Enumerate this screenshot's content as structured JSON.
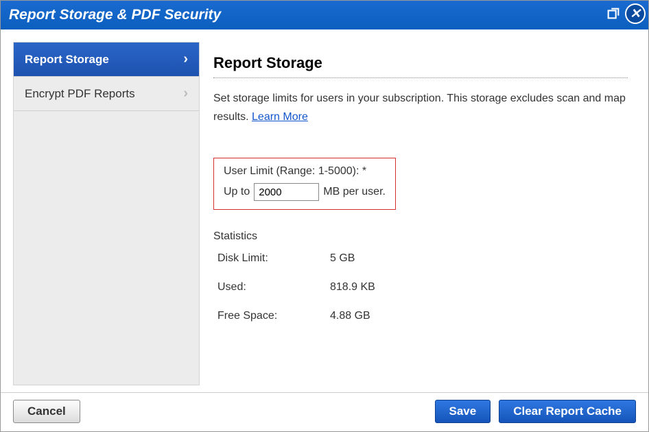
{
  "title": "Report Storage & PDF Security",
  "sidebar": {
    "items": [
      {
        "label": "Report Storage",
        "active": true
      },
      {
        "label": "Encrypt PDF Reports",
        "active": false
      }
    ]
  },
  "main": {
    "heading": "Report Storage",
    "description_1": "Set storage limits for users in your subscription. This storage excludes scan and map results. ",
    "learn_more": "Learn More",
    "user_limit_label": "User Limit (Range: 1-5000): *",
    "upto_prefix": "Up to",
    "upto_value": "2000",
    "upto_suffix": "MB per user.",
    "stats_heading": "Statistics",
    "stats": [
      {
        "label": "Disk Limit:",
        "value": "5 GB"
      },
      {
        "label": "Used:",
        "value": "818.9 KB"
      },
      {
        "label": "Free Space:",
        "value": "4.88 GB"
      }
    ]
  },
  "footer": {
    "cancel": "Cancel",
    "save": "Save",
    "clear": "Clear Report Cache"
  }
}
